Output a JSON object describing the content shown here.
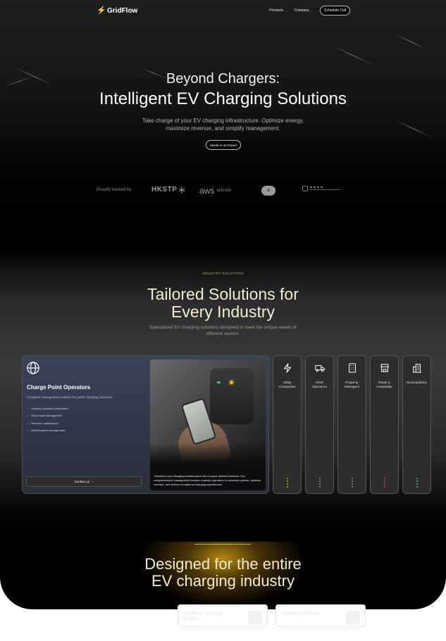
{
  "nav": {
    "logo": "GridFlow",
    "products": "Products",
    "company": "Company",
    "schedule_call": "Schedule Call"
  },
  "hero": {
    "line1": "Beyond Chargers:",
    "line2": "Intelligent EV Charging Solutions",
    "subtitle": "Take charge of your EV charging infrastructure. Optimize energy, maximize revenue, and simplify management.",
    "cta": "Speak to an Expert"
  },
  "backers": {
    "label": "Proudly backed by",
    "hkstp": "HKSTP",
    "aws": "aws",
    "aws_activate": "activate"
  },
  "industry": {
    "eyebrow": "INDUSTRY SOLUTIONS",
    "title_line1": "Tailored Solutions for",
    "title_line2": "Every Industry",
    "subtitle": "Specialized EV charging solutions designed to meet the unique needs of different sectors."
  },
  "featured": {
    "title": "Charge Point Operators",
    "description": "Complete management solution for public charging networks.",
    "features": [
      "Network operation dashboard",
      "Smart load management",
      "Revenue optimization",
      "Multi-location management"
    ],
    "contact": "Contact us",
    "caption": "Transform your charging infrastructure into a smart, efficient network. Our comprehensive management solution enables operators to maximize uptime, optimize revenue, and deliver exceptional charging experiences."
  },
  "industries": [
    {
      "label_line1": "Utility",
      "label_line2": "Companies",
      "icon": "lightning-icon",
      "dot_color": "#c9a227"
    },
    {
      "label_line1": "Fleet",
      "label_line2": "Operators",
      "icon": "truck-icon",
      "dot_color": "#6b8fd6"
    },
    {
      "label_line1": "Property",
      "label_line2": "Managers",
      "icon": "building-icon",
      "dot_color": "#4fb08c"
    },
    {
      "label_line1": "Retail &",
      "label_line2": "Hospitality",
      "icon": "store-icon",
      "dot_color": "#c0466e"
    },
    {
      "label_line1": "Municipalities",
      "label_line2": "",
      "icon": "city-icon",
      "dot_color": "#4fb08c"
    }
  ],
  "bottom": {
    "title_line1": "Designed for the entire",
    "title_line2": "EV charging industry",
    "card1": "GridFlow Cloud & Control",
    "card2": "GridFlow Charge"
  },
  "colors": {
    "accent": "#f5c518",
    "eyebrow": "#e0b13a",
    "card_bg": "#3a4458"
  }
}
